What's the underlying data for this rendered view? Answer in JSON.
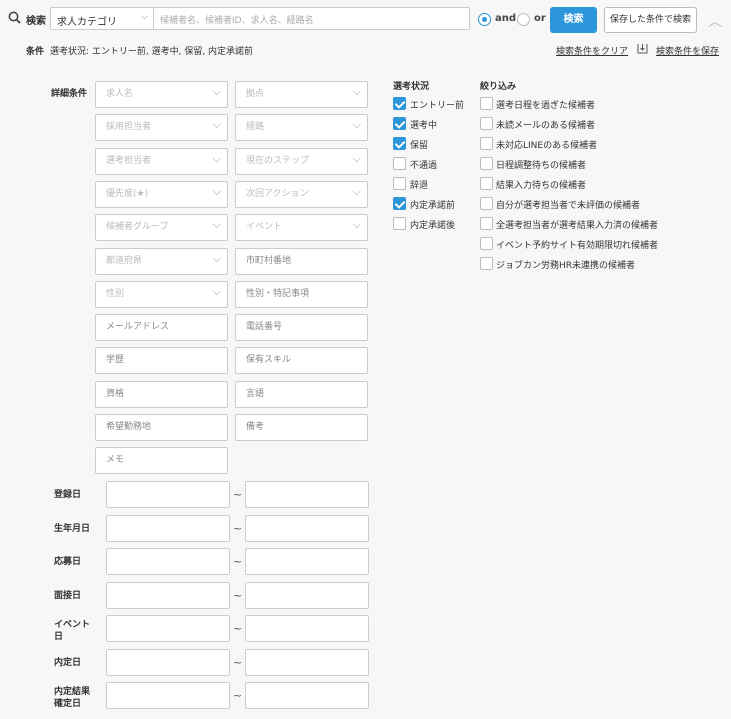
{
  "search": {
    "label": "検索",
    "category": "求人カテゴリ",
    "placeholder": "候補者名、候補者ID、求人名、経路名",
    "and_label": "and",
    "or_label": "or",
    "and_selected": true,
    "button": "検索",
    "saved_button": "保存した条件で検索"
  },
  "conditions": {
    "label": "条件",
    "text": "選考状況: エントリー前, 選考中, 保留, 内定承諾前",
    "clear_link": "検索条件をクリア",
    "save_link": "検索条件を保存"
  },
  "detail": {
    "title": "詳細条件",
    "fields": [
      {
        "label": "求人名",
        "type": "select"
      },
      {
        "label": "拠点",
        "type": "select"
      },
      {
        "label": "採用担当者",
        "type": "select"
      },
      {
        "label": "経路",
        "type": "select"
      },
      {
        "label": "選考担当者",
        "type": "select"
      },
      {
        "label": "現在のステップ",
        "type": "select"
      },
      {
        "label": "優先度(★)",
        "type": "select"
      },
      {
        "label": "次回アクション",
        "type": "select"
      },
      {
        "label": "候補者グループ",
        "type": "select"
      },
      {
        "label": "イベント",
        "type": "select"
      },
      {
        "label": "都道府県",
        "type": "select"
      },
      {
        "label": "市町村番地",
        "type": "text"
      },
      {
        "label": "性別",
        "type": "select"
      },
      {
        "label": "性別・特記事項",
        "type": "text"
      },
      {
        "label": "メールアドレス",
        "type": "text"
      },
      {
        "label": "電話番号",
        "type": "text"
      },
      {
        "label": "学歴",
        "type": "text"
      },
      {
        "label": "保有スキル",
        "type": "text"
      },
      {
        "label": "資格",
        "type": "text"
      },
      {
        "label": "言語",
        "type": "text"
      },
      {
        "label": "希望勤務地",
        "type": "text"
      },
      {
        "label": "備考",
        "type": "text"
      },
      {
        "label": "メモ",
        "type": "text"
      }
    ]
  },
  "dates": [
    {
      "label": "登録日"
    },
    {
      "label": "生年月日"
    },
    {
      "label": "応募日"
    },
    {
      "label": "面接日"
    },
    {
      "label": "イベント\n日"
    },
    {
      "label": "内定日"
    },
    {
      "label": "内定結果\n確定日"
    }
  ],
  "tilde": "~",
  "status": {
    "title": "選考状況",
    "items": [
      {
        "label": "エントリー前",
        "checked": true
      },
      {
        "label": "選考中",
        "checked": true
      },
      {
        "label": "保留",
        "checked": true
      },
      {
        "label": "不通過",
        "checked": false
      },
      {
        "label": "辞退",
        "checked": false
      },
      {
        "label": "内定承諾前",
        "checked": true
      },
      {
        "label": "内定承諾後",
        "checked": false
      }
    ]
  },
  "filter": {
    "title": "絞り込み",
    "items": [
      {
        "label": "選考日程を過ぎた候補者",
        "checked": false
      },
      {
        "label": "未読メールのある候補者",
        "checked": false
      },
      {
        "label": "未対応LINEのある候補者",
        "checked": false
      },
      {
        "label": "日程調整待ちの候補者",
        "checked": false
      },
      {
        "label": "結果入力待ちの候補者",
        "checked": false
      },
      {
        "label": "自分が選考担当者で未評価の候補者",
        "checked": false
      },
      {
        "label": "全選考担当者が選考結果入力済の候補者",
        "checked": false
      },
      {
        "label": "イベント予約サイト有効期限切れ候補者",
        "checked": false
      },
      {
        "label": "ジョブカン労務HR未連携の候補者",
        "checked": false
      }
    ]
  },
  "colors": {
    "accent": "#2b96d9",
    "background": "#f7f7f7"
  }
}
